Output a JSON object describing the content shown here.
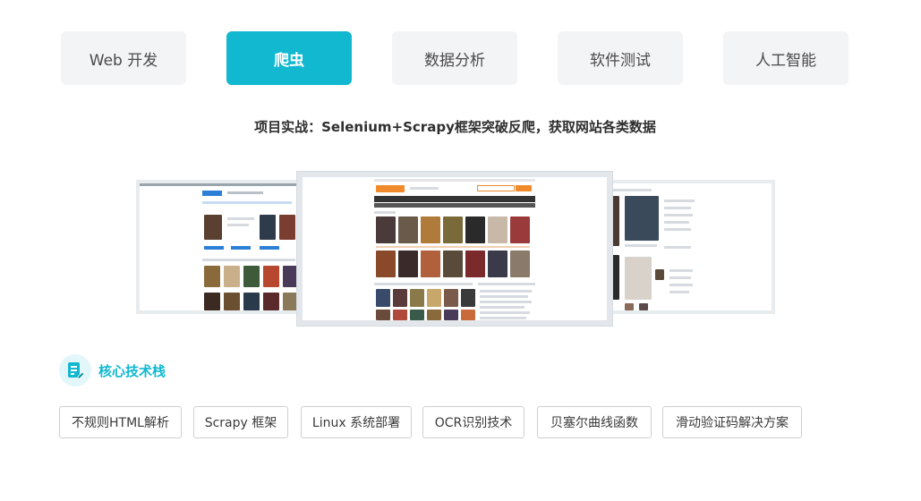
{
  "tabs": [
    {
      "label": "Web 开发",
      "active": false
    },
    {
      "label": "爬虫",
      "active": true
    },
    {
      "label": "数据分析",
      "active": false
    },
    {
      "label": "软件测试",
      "active": false
    },
    {
      "label": "人工智能",
      "active": false
    }
  ],
  "project": {
    "title": "项目实战：Selenium+Scrapy框架突破反爬，获取网站各类数据"
  },
  "core_stack": {
    "title": "核心技术栈",
    "icon": "document-edit-icon",
    "tags": [
      "不规则HTML解析",
      "Scrapy 框架",
      "Linux 系统部署",
      "OCR识别技术",
      "贝塞尔曲线函数",
      "滑动验证码解决方案"
    ]
  },
  "colors": {
    "accent": "#12b8d0",
    "tab_bg": "#f3f4f6",
    "tag_border": "#cfcfcf"
  }
}
